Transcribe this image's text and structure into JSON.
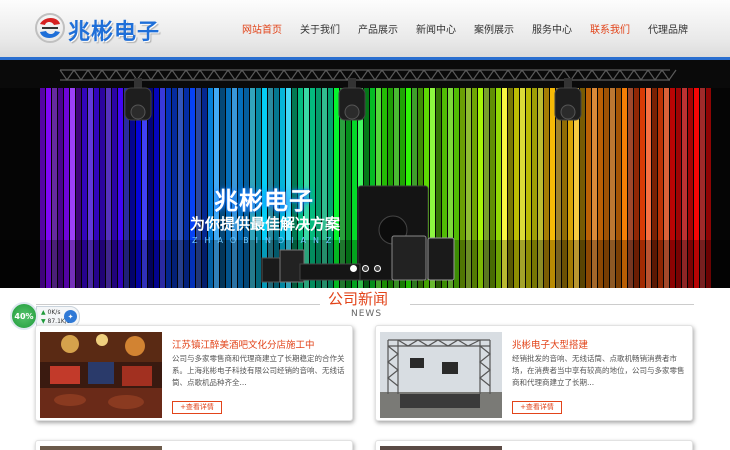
{
  "header": {
    "logo_text": "兆彬电子",
    "nav": [
      {
        "label": "网站首页",
        "state": "active"
      },
      {
        "label": "关于我们",
        "state": ""
      },
      {
        "label": "产品展示",
        "state": ""
      },
      {
        "label": "新闻中心",
        "state": ""
      },
      {
        "label": "案例展示",
        "state": ""
      },
      {
        "label": "服务中心",
        "state": ""
      },
      {
        "label": "联系我们",
        "state": "highlight"
      },
      {
        "label": "代理品牌",
        "state": ""
      }
    ]
  },
  "banner": {
    "title": "兆彬电子",
    "slogan": "为你提供最佳解决方案",
    "pinyin": "ZHAOBINDIANZI",
    "slides": 3,
    "active_slide": 1
  },
  "section": {
    "title": "公司新闻",
    "subtitle": "NEWS"
  },
  "speed_widget": {
    "percent": "40%",
    "upload": "0K/s",
    "download": "87.1K/s"
  },
  "news": [
    {
      "title": "江苏镇江醉美酒吧文化分店施工中",
      "desc": "公司与多家零售商和代理商建立了长期稳定的合作关系。上海兆彬电子科技有限公司经销的音响、无线话筒、点歌机品种齐全...",
      "button": "+查看详情",
      "image": "bar-interior-photo"
    },
    {
      "title": "兆彬电子大型搭建",
      "desc": "经销批发的音响、无线话筒、点歌机畅销消费者市场，在消费者当中享有较高的地位，公司与多家零售商和代理商建立了长期...",
      "button": "+查看详情",
      "image": "stage-truss-photo"
    }
  ],
  "colors": {
    "accent": "#e2441a",
    "brand_blue": "#1f6fd8",
    "header_rule": "#2a6fd0"
  }
}
